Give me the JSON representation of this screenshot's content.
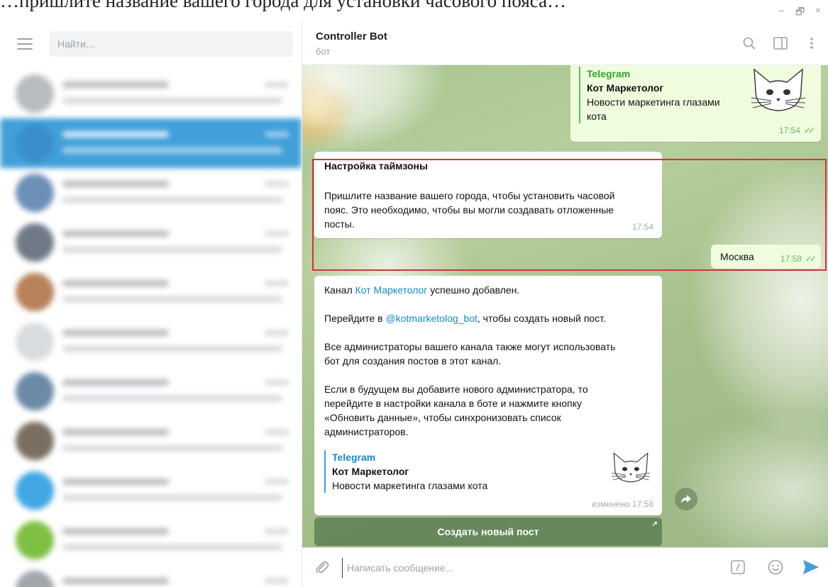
{
  "caption_fragment": "…пришлите название вашего города для установки часового пояса…",
  "window_controls": {
    "minimize": "–",
    "restore": "🗗",
    "close": "×"
  },
  "sidebar": {
    "search": {
      "placeholder": "Найти..."
    },
    "chat_rows": [
      {
        "avatar_color": "#b7bcc0",
        "active": false
      },
      {
        "avatar_color": "#3a8fcb",
        "active": true
      },
      {
        "avatar_color": "#6c8fb8",
        "active": false
      },
      {
        "avatar_color": "#6f7a86",
        "active": false
      },
      {
        "avatar_color": "#b7825a",
        "active": false
      },
      {
        "avatar_color": "#d9dcdf",
        "active": false
      },
      {
        "avatar_color": "#6b8aa6",
        "active": false
      },
      {
        "avatar_color": "#7b6f62",
        "active": false
      },
      {
        "avatar_color": "#40a7e3",
        "active": false
      },
      {
        "avatar_color": "#7ec043",
        "active": false
      },
      {
        "avatar_color": "#a0a6ab",
        "active": false
      }
    ]
  },
  "chat": {
    "title": "Controller Bot",
    "subtitle": "бот",
    "messages": {
      "top_preview": {
        "site": "Telegram",
        "title": "Кот Маркетолог",
        "desc_1": "Новости маркетинга глазами",
        "desc_2": "кота",
        "time": "17:54"
      },
      "timezone": {
        "heading": "Настройка таймзоны",
        "line_1": "Пришлите название вашего города, чтобы установить часовой",
        "line_2": "пояс. Это необходимо, чтобы вы могли создавать отложенные",
        "line_3": "посты.",
        "time": "17:54"
      },
      "city_reply": {
        "text": "Москва",
        "time": "17:58"
      },
      "added": {
        "p1_pre": "Канал ",
        "p1_link": "Кот Маркетолог",
        "p1_post": " успешно добавлен.",
        "p2_pre": "Перейдите в ",
        "p2_link": "@kotmarketolog_bot",
        "p2_post": ", чтобы создать новый пост.",
        "p3_1": "Все администраторы вашего канала также могут использовать",
        "p3_2": "бот для создания постов в этот канал.",
        "p4_1": "Если в будущем вы добавите нового администратора, то",
        "p4_2": "перейдите в настройки канала в боте и нажмите кнопку",
        "p4_3": "«Обновить данные», чтобы синхронизовать список",
        "p4_4": "администраторов.",
        "preview": {
          "site": "Telegram",
          "title": "Кот Маркетолог",
          "desc": "Новости маркетинга глазами кота"
        },
        "time": "изменено 17:58"
      }
    },
    "keyboard_button": "Создать новый пост",
    "composer": {
      "placeholder": "Написать сообщение..."
    }
  },
  "colors": {
    "accent": "#419fd9",
    "highlight": "#c8383a",
    "outgoing": "#effdde"
  }
}
